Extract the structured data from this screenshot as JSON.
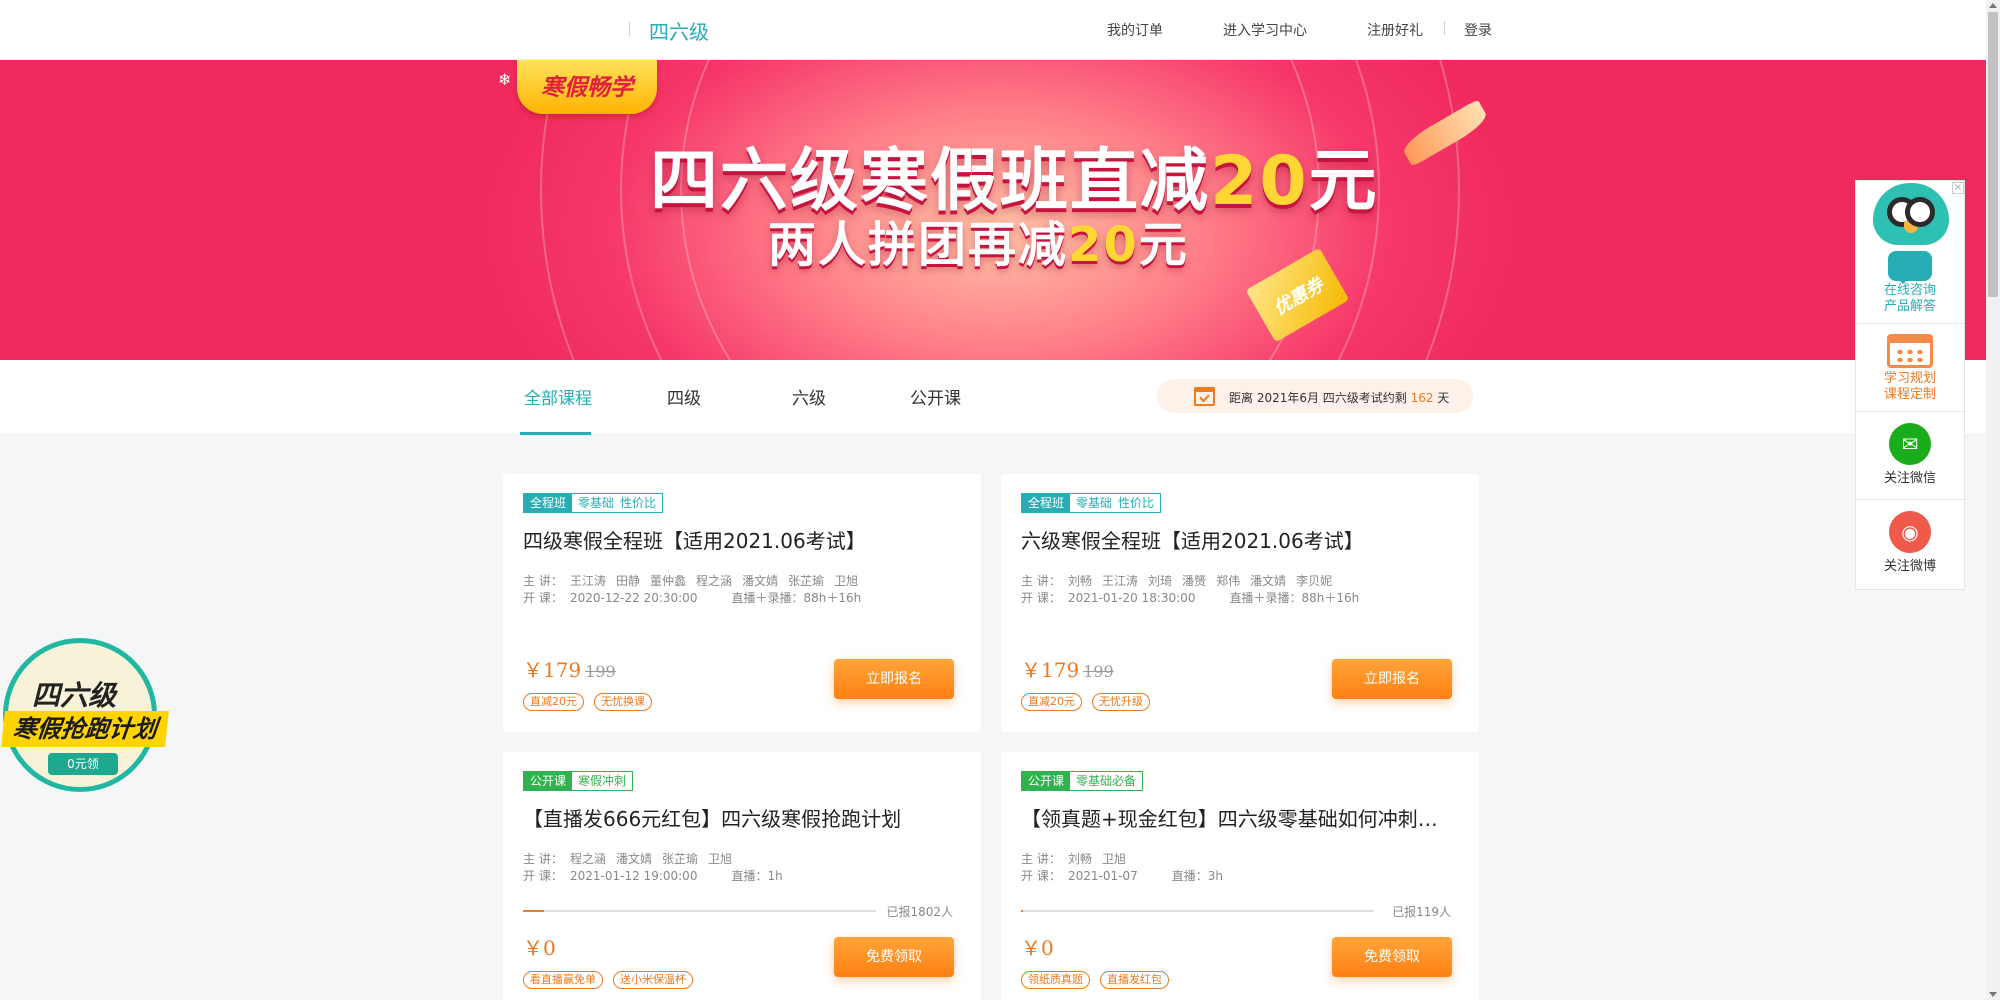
{
  "header": {
    "brand": "四六级",
    "nav": [
      "我的订单",
      "进入学习中心",
      "注册好礼",
      "登录"
    ]
  },
  "banner": {
    "badge": "寒假畅学",
    "headline1_prefix": "四六级寒假班直减",
    "headline1_num": "20",
    "headline1_suffix": "元",
    "headline2_prefix": "两人拼团再减",
    "headline2_num": "20",
    "headline2_suffix": "元",
    "coupon": "优惠券"
  },
  "tabs": [
    "全部课程",
    "四级",
    "六级",
    "公开课"
  ],
  "countdown": {
    "prefix": "距离 2021年6月 四六级考试约剩",
    "days": "162",
    "suffix": "天"
  },
  "labels": {
    "teacher": "主 讲：",
    "start": "开 课："
  },
  "courses": [
    {
      "tag": "全程班",
      "subtags": [
        "零基础",
        "性价比"
      ],
      "title": "四级寒假全程班【适用2021.06考试】",
      "teachers": [
        "王江涛",
        "田静",
        "董仲蠡",
        "程之涵",
        "潘文婧",
        "张芷瑜",
        "卫旭"
      ],
      "start": "2020-12-22 20:30:00",
      "mode": "直播＋录播：88h＋16h",
      "price": "￥179",
      "orig": "199",
      "ptags": [
        "直减20元",
        "无忧换课"
      ],
      "button": "立即报名"
    },
    {
      "tag": "全程班",
      "subtags": [
        "零基础",
        "性价比"
      ],
      "title": "六级寒假全程班【适用2021.06考试】",
      "teachers": [
        "刘畅",
        "王江涛",
        "刘琦",
        "潘赟",
        "郑伟",
        "潘文婧",
        "李贝妮"
      ],
      "start": "2021-01-20 18:30:00",
      "mode": "直播＋录播：88h＋16h",
      "price": "￥179",
      "orig": "199",
      "ptags": [
        "直减20元",
        "无忧升级"
      ],
      "button": "立即报名"
    },
    {
      "tag": "公开课",
      "subtags": [
        "寒假冲刺"
      ],
      "title": "【直播发666元红包】四六级寒假抢跑计划",
      "teachers": [
        "程之涵",
        "潘文婧",
        "张芷瑜",
        "卫旭"
      ],
      "start": "2021-01-12 19:00:00",
      "mode": "直播：1h",
      "enrolled": "已报1802人",
      "progress_pct": 6,
      "price": "￥0",
      "ptags": [
        "看直播赢免单",
        "送小米保温杯"
      ],
      "button": "免费领取"
    },
    {
      "tag": "公开课",
      "subtags": [
        "零基础必备"
      ],
      "title": "【领真题+现金红包】四六级零基础如何冲刺…",
      "teachers": [
        "刘畅",
        "卫旭"
      ],
      "start": "2021-01-07",
      "mode": "直播：3h",
      "enrolled": "已报119人",
      "progress_pct": 0.5,
      "price": "￥0",
      "ptags": [
        "领纸质真题",
        "直播发红包"
      ],
      "button": "免费领取"
    }
  ],
  "sidebar": {
    "consult": [
      "在线咨询",
      "产品解答"
    ],
    "plan": [
      "学习规划",
      "课程定制"
    ],
    "wechat": "关注微信",
    "weibo": "关注微博",
    "close": "×"
  },
  "promo": {
    "line1": "四六级",
    "line2": "寒假抢跑计划",
    "line3": "0元领"
  },
  "colors": {
    "accent": "#27aeb5",
    "orange": "#f0781e",
    "green": "#2fb34e",
    "banner": "#f6376a"
  },
  "icons": [
    "calendar-icon",
    "chat-icon",
    "planner-icon",
    "wechat-icon",
    "weibo-icon",
    "mascot-icon",
    "close-icon"
  ]
}
